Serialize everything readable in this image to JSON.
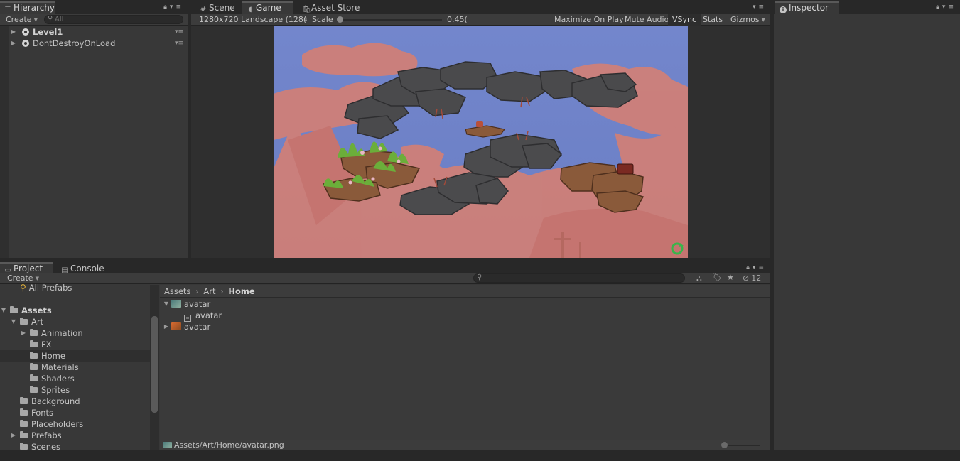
{
  "hierarchy": {
    "tab": "Hierarchy",
    "create": "Create",
    "search_placeholder": "All",
    "items": [
      {
        "label": "Level1"
      },
      {
        "label": "DontDestroyOnLoad"
      }
    ]
  },
  "center_tabs": {
    "scene": "Scene",
    "game": "Game",
    "asset_store": "Asset Store"
  },
  "game_toolbar": {
    "resolution": "1280x720 Landscape (128(",
    "scale_label": "Scale",
    "scale_value": "0.45(",
    "maximize": "Maximize On Play",
    "mute": "Mute Audio",
    "vsync": "VSync",
    "stats": "Stats",
    "gizmos": "Gizmos"
  },
  "inspector": {
    "tab": "Inspector"
  },
  "project": {
    "tab_project": "Project",
    "tab_console": "Console",
    "create": "Create",
    "hidden_count": "12",
    "tree": {
      "all_prefabs": "All Prefabs",
      "assets": "Assets",
      "art": "Art",
      "animation": "Animation",
      "fx": "FX",
      "home": "Home",
      "materials": "Materials",
      "shaders": "Shaders",
      "sprites": "Sprites",
      "background": "Background",
      "fonts": "Fonts",
      "placeholders": "Placeholders",
      "prefabs": "Prefabs",
      "scenes": "Scenes"
    },
    "breadcrumb": [
      "Assets",
      "Art",
      "Home"
    ],
    "files": [
      {
        "label": "avatar"
      },
      {
        "label": "avatar"
      },
      {
        "label": "avatar"
      }
    ],
    "status_path": "Assets/Art/Home/avatar.png"
  },
  "colors": {
    "sky": "#6f82c8",
    "cloud": "#d08078",
    "rock": "#4b4b4d",
    "brown_rock": "#8a5a3a",
    "plant": "#6bae3a"
  }
}
